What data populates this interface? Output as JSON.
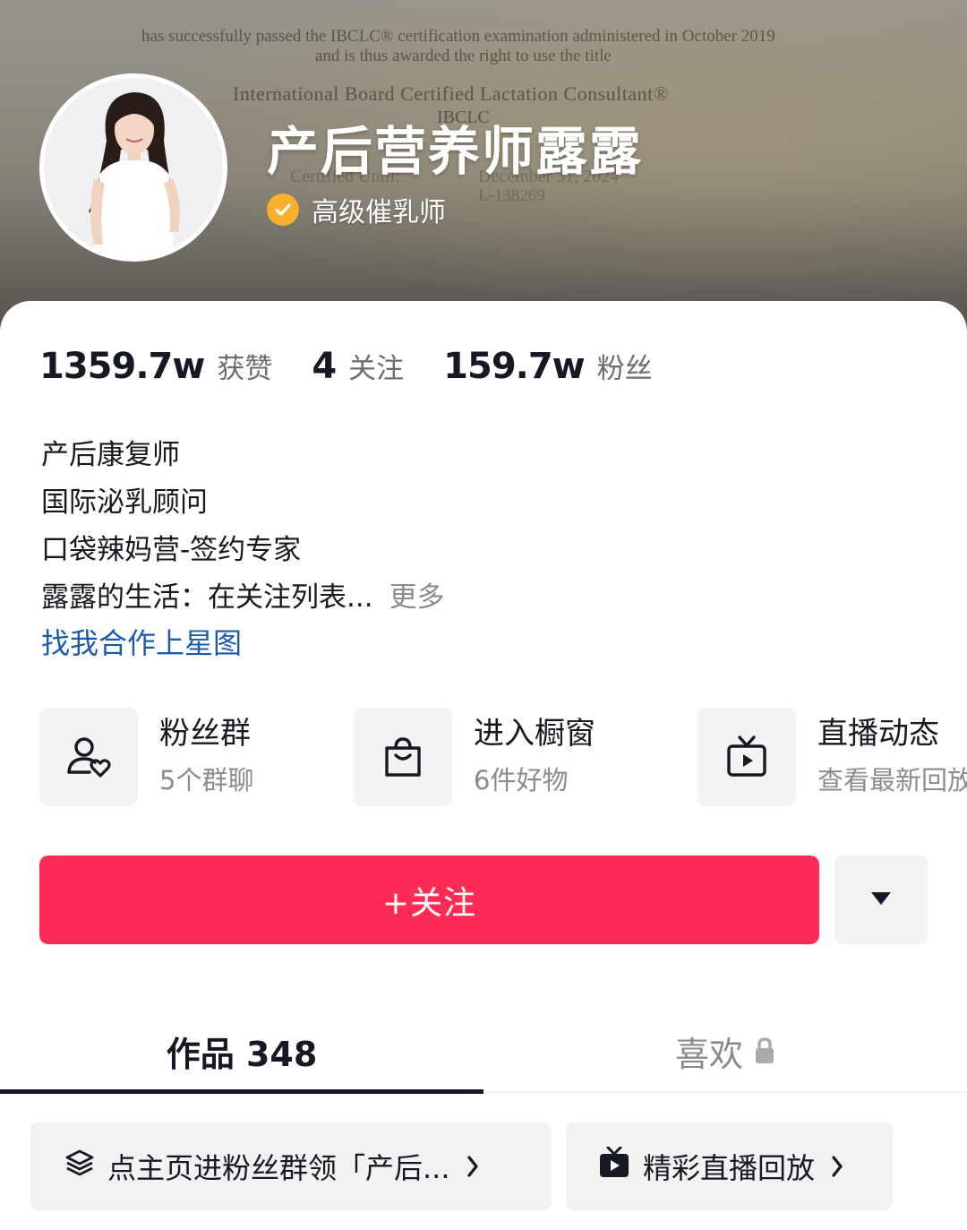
{
  "cover": {
    "cert_lines": [
      "has successfully passed the IBCLC® certification examination administered in October 2019",
      "and is thus awarded the right to use the title",
      "International Board Certified Lactation Consultant®",
      "IBCLC",
      "Certified Until:",
      "December 31, 2024",
      "L-138269"
    ]
  },
  "profile": {
    "name": "产后营养师露露",
    "verification": "高级催乳师",
    "verification_color": "#f6b02c"
  },
  "stats": [
    {
      "value": "1359.7w",
      "label": "获赞"
    },
    {
      "value": "4",
      "label": "关注"
    },
    {
      "value": "159.7w",
      "label": "粉丝"
    }
  ],
  "bio": {
    "lines": [
      "产后康复师",
      "国际泌乳顾问",
      "口袋辣妈营-签约专家",
      "露露的生活：在关注列表..."
    ],
    "more_label": "更多",
    "link_label": "找我合作上星图",
    "link_color": "#1d5aa8"
  },
  "shortcuts": [
    {
      "icon": "fan-group-icon",
      "title": "粉丝群",
      "subtitle": "5个群聊"
    },
    {
      "icon": "shopping-bag-icon",
      "title": "进入橱窗",
      "subtitle": "6件好物"
    },
    {
      "icon": "live-tv-icon",
      "title": "直播动态",
      "subtitle": "查看最新回放"
    }
  ],
  "actions": {
    "follow_label": "+关注",
    "follow_color": "#fe2c55",
    "more_icon": "triangle-down-icon"
  },
  "tabs": [
    {
      "label": "作品 348",
      "active": true
    },
    {
      "label": "喜欢",
      "active": false,
      "icon": "lock-icon"
    }
  ],
  "chips": [
    {
      "icon": "layers-icon",
      "label": "点主页进粉丝群领「产后..."
    },
    {
      "icon": "live-replay-icon",
      "label": "精彩直播回放"
    }
  ]
}
